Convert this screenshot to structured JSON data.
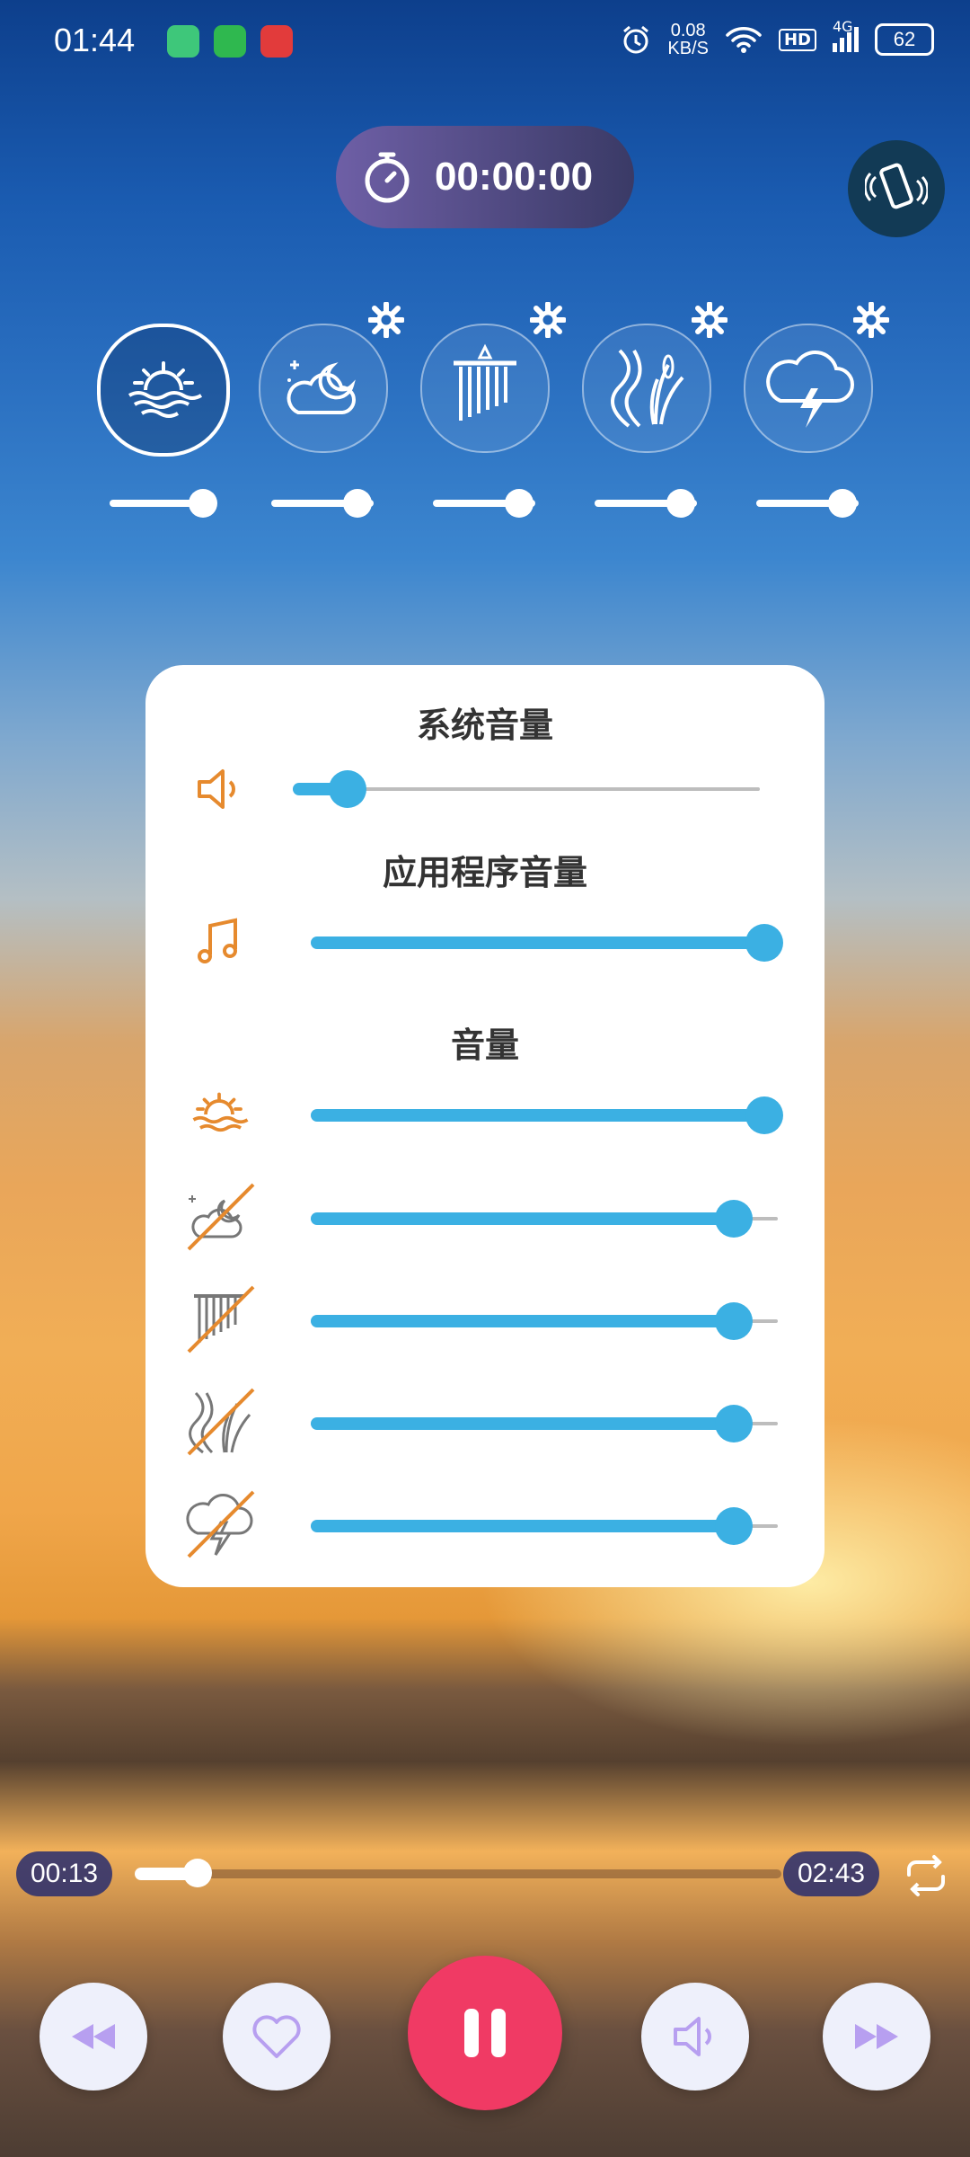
{
  "status_bar": {
    "time": "01:44",
    "net_speed_value": "0.08",
    "net_speed_unit": "KB/S",
    "hd": "HD",
    "network": "4G",
    "battery": "62"
  },
  "timer": {
    "display": "00:00:00"
  },
  "sounds": [
    {
      "name": "sunset-sea",
      "icon": "sun-sea-icon",
      "active": true
    },
    {
      "name": "night",
      "icon": "moon-cloud-icon",
      "active": false
    },
    {
      "name": "wind-chime",
      "icon": "wind-chime-icon",
      "active": false
    },
    {
      "name": "reeds",
      "icon": "reed-icon",
      "active": false
    },
    {
      "name": "thunderstorm",
      "icon": "thunder-cloud-icon",
      "active": false
    }
  ],
  "dialog": {
    "system_volume_label": "系统音量",
    "system_volume": 0.12,
    "app_volume_label": "应用程序音量",
    "app_volume": 1.0,
    "volume_label": "音量",
    "sound_volumes": [
      {
        "icon": "sun-sea-icon",
        "muted": false,
        "value": 1.0
      },
      {
        "icon": "moon-cloud-icon",
        "muted": true,
        "value": 0.92
      },
      {
        "icon": "wind-chime-icon",
        "muted": true,
        "value": 0.92
      },
      {
        "icon": "reed-icon",
        "muted": true,
        "value": 0.92
      },
      {
        "icon": "thunder-cloud-icon",
        "muted": true,
        "value": 0.92
      }
    ]
  },
  "player": {
    "elapsed": "00:13",
    "total": "02:43",
    "progress": 0.08
  },
  "colors": {
    "accent": "#3bb0e3",
    "icon_orange": "#e68a2e",
    "play": "#f03a64",
    "control_purple": "#b79ff0"
  }
}
